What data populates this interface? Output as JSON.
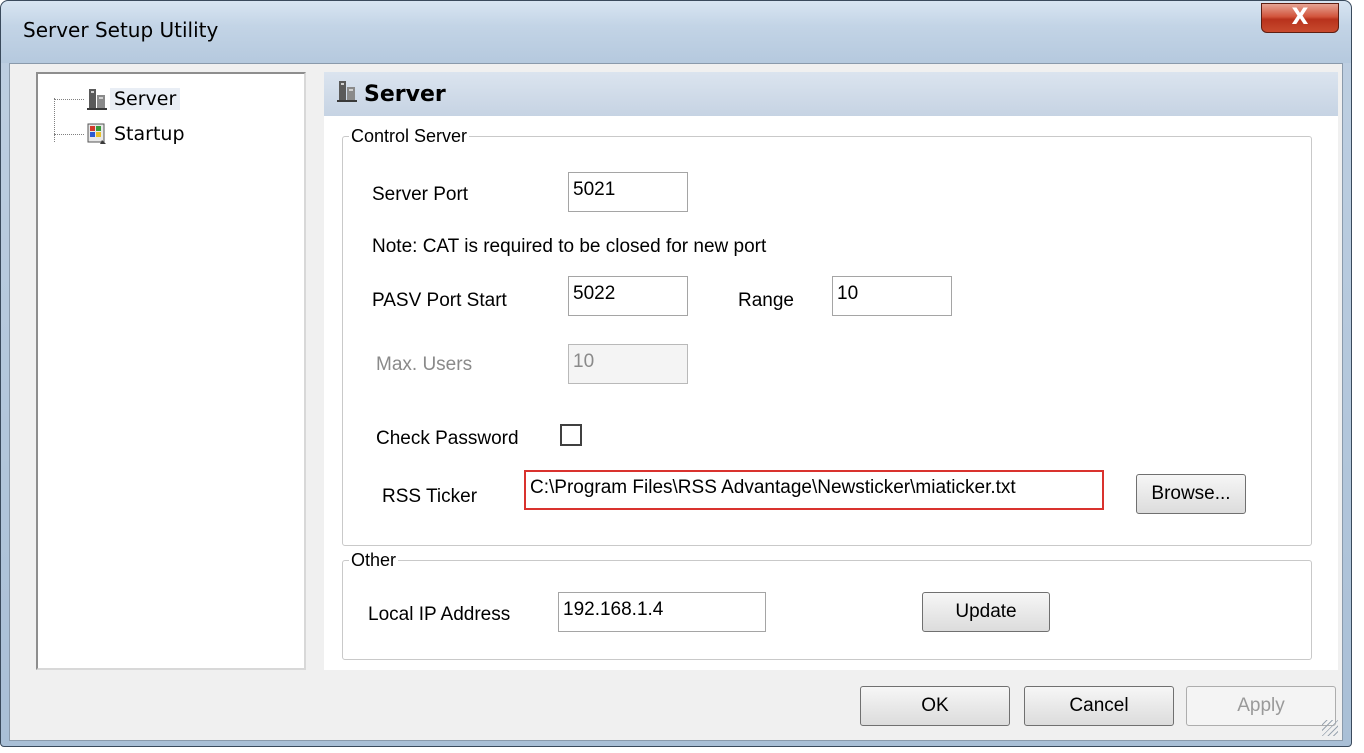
{
  "window": {
    "title": "Server Setup Utility",
    "close_glyph": "X"
  },
  "tree": {
    "items": [
      {
        "label": "Server",
        "icon": "server-icon",
        "selected": true
      },
      {
        "label": "Startup",
        "icon": "startup-icon",
        "selected": false
      }
    ]
  },
  "panel": {
    "title": "Server"
  },
  "control_server": {
    "legend": "Control Server",
    "server_port": {
      "label": "Server Port",
      "value": "5021"
    },
    "note": "Note: CAT is required to be closed  for new port",
    "pasv_port_start": {
      "label": "PASV Port Start",
      "value": "5022"
    },
    "range": {
      "label": "Range",
      "value": "10"
    },
    "max_users": {
      "label": "Max. Users",
      "value": "10",
      "disabled": true
    },
    "check_password": {
      "label": "Check Password",
      "checked": false
    },
    "rss_ticker": {
      "label": "RSS Ticker",
      "value": "C:\\Program Files\\RSS Advantage\\Newsticker\\miaticker.txt"
    },
    "browse_label": "Browse..."
  },
  "other": {
    "legend": "Other",
    "local_ip": {
      "label": "Local IP Address",
      "value": "192.168.1.4"
    },
    "update_label": "Update"
  },
  "buttons": {
    "ok": "OK",
    "cancel": "Cancel",
    "apply": "Apply",
    "apply_disabled": true
  }
}
